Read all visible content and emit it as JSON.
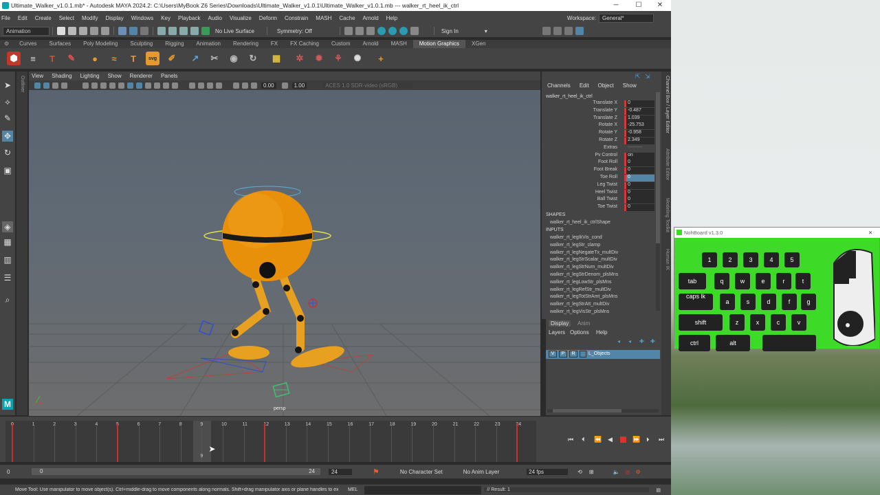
{
  "window": {
    "title": "Ultimate_Walker_v1.0.1.mb* - Autodesk MAYA 2024.2: C:\\Users\\MyBook Z6 Series\\Downloads\\Ultimate_Walker_v1.0.1\\Ultimate_Walker_v1.0.1.mb  ---  walker_rt_heel_ik_ctrl",
    "minimize": "─",
    "maximize": "☐",
    "close": "✕"
  },
  "menu": [
    "File",
    "Edit",
    "Create",
    "Select",
    "Modify",
    "Display",
    "Windows",
    "Key",
    "Playback",
    "Audio",
    "Visualize",
    "Deform",
    "Constrain",
    "MASH",
    "Cache",
    "Arnold",
    "Help"
  ],
  "workspace": {
    "label": "Workspace:",
    "value": "General*"
  },
  "statusline": {
    "mode": "Animation",
    "live_surface": "No Live Surface",
    "symmetry": "Symmetry: Off",
    "sign_in": "Sign In"
  },
  "shelf_tabs": [
    "Curves",
    "Surfaces",
    "Poly Modeling",
    "Sculpting",
    "Rigging",
    "Animation",
    "Rendering",
    "FX",
    "FX Caching",
    "Custom",
    "Arnold",
    "MASH",
    "Motion Graphics",
    "XGen"
  ],
  "active_shelf": "Motion Graphics",
  "outliner_label": "Outliner",
  "viewport": {
    "menus": [
      "View",
      "Shading",
      "Lighting",
      "Show",
      "Renderer",
      "Panels"
    ],
    "val1": "0.00",
    "val2": "1.00",
    "colorspace": "ACES 1.0 SDR-video (sRGB)",
    "camera": "persp"
  },
  "channel_box": {
    "menus": [
      "Channels",
      "Edit",
      "Object",
      "Show"
    ],
    "node": "walker_rt_heel_ik_ctrl",
    "attributes": [
      {
        "name": "Translate X",
        "value": "0"
      },
      {
        "name": "Translate Y",
        "value": "-0.487"
      },
      {
        "name": "Translate Z",
        "value": "1.039"
      },
      {
        "name": "Rotate X",
        "value": "-25.753"
      },
      {
        "name": "Rotate Y",
        "value": "-0.958"
      },
      {
        "name": "Rotate Z",
        "value": "2.349"
      },
      {
        "name": "Extras",
        "value": "---------"
      },
      {
        "name": "Pv Control",
        "value": "on"
      },
      {
        "name": "Foot Roll",
        "value": "0"
      },
      {
        "name": "Foot Break",
        "value": "0"
      },
      {
        "name": "Toe Roll",
        "value": "0"
      },
      {
        "name": "Leg Twist",
        "value": "0"
      },
      {
        "name": "Heel Twist",
        "value": "0"
      },
      {
        "name": "Ball Twist",
        "value": "0"
      },
      {
        "name": "Toe Twist",
        "value": "0"
      }
    ],
    "shapes_label": "SHAPES",
    "shape": "walker_rt_heel_ik_ctrlShape",
    "inputs_label": "INPUTS",
    "inputs": [
      "walker_rt_legIkVis_cond",
      "walker_rt_legStr_clamp",
      "walker_rt_legNegateTx_multDiv",
      "walker_rt_legStrScalar_multDiv",
      "walker_rt_legStrNum_multDiv",
      "walker_rt_legStrDenom_plsMns",
      "walker_rt_legLowStr_plsMns",
      "walker_rt_legRefStr_multDiv",
      "walker_rt_legTotStrAmt_plsMns",
      "walker_rt_legStrAtt_multDiv",
      "walker_rt_legVisStr_plsMns"
    ]
  },
  "side_tabs": [
    "Channel Box / Layer Editor",
    "Attribute Editor",
    "Modeling Toolkit",
    "Human IK"
  ],
  "layer_editor": {
    "tabs": [
      "Display",
      "Anim"
    ],
    "menus": [
      "Layers",
      "Options",
      "Help"
    ],
    "layer": {
      "v": "V",
      "p": "P",
      "r": "R",
      "name": "L_Objects"
    }
  },
  "timeline": {
    "ticks": [
      "0",
      "1",
      "2",
      "3",
      "4",
      "5",
      "6",
      "7",
      "8",
      "9",
      "10",
      "11",
      "12",
      "13",
      "14",
      "15",
      "16",
      "17",
      "18",
      "19",
      "20",
      "21",
      "22",
      "23",
      "24"
    ],
    "current": "9",
    "keyframes": [
      0,
      5,
      12,
      24
    ]
  },
  "range": {
    "start": "0",
    "inner_start": "0",
    "inner_end": "24",
    "end": "24",
    "character_set": "No Character Set",
    "anim_layer": "No Anim Layer",
    "fps": "24 fps"
  },
  "cmd": {
    "status": "Move Tool: Use manipulator to move object(s). Ctrl+middle-drag to move components along normals. Shift+drag manipulator axis or plane handles to extrude",
    "lang": "MEL",
    "result": "// Result: 1"
  },
  "nohboard": {
    "title": "NohBoard v1.3.0",
    "keys": [
      "1",
      "2",
      "3",
      "4",
      "5",
      "tab",
      "q",
      "w",
      "e",
      "r",
      "t",
      "caps lk",
      "a",
      "s",
      "d",
      "f",
      "g",
      "shift",
      "z",
      "x",
      "c",
      "v",
      "ctrl",
      "alt"
    ]
  },
  "colors": {
    "accent_blue": "#5285a6",
    "keyframe_red": "#c83030",
    "nohboard_green": "#3ddb27"
  }
}
